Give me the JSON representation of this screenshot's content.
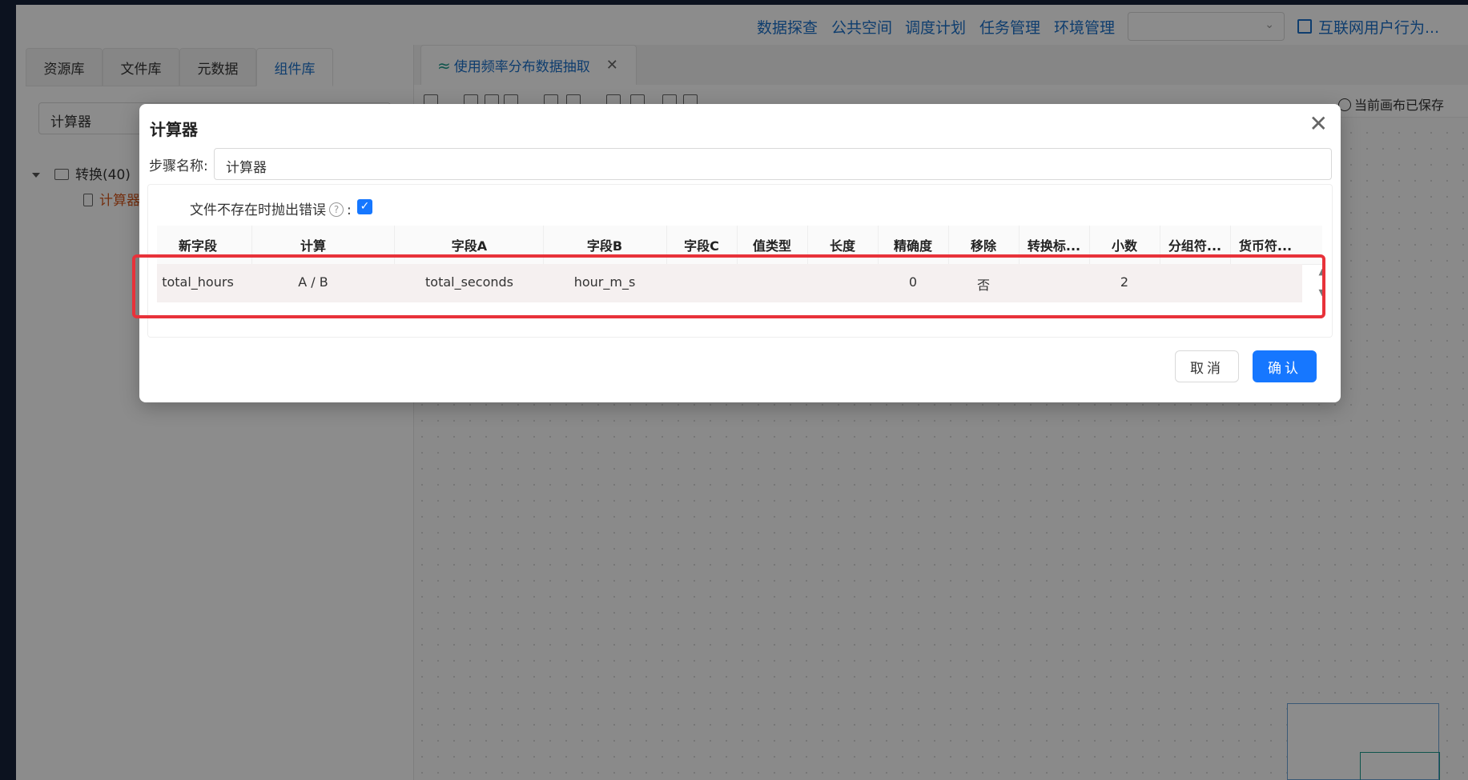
{
  "nav": {
    "items": [
      "数据探查",
      "公共空间",
      "调度计划",
      "任务管理",
      "环境管理"
    ],
    "project": "互联网用户行为..."
  },
  "left": {
    "tabs": [
      "资源库",
      "文件库",
      "元数据",
      "组件库"
    ],
    "active_tab": "组件库",
    "search_value": "计算器",
    "tree": {
      "folder": "转换(40)",
      "item": "计算器"
    }
  },
  "right": {
    "tab_title": "使用频率分布数据抽取",
    "save_status": "当前画布已保存"
  },
  "dialog": {
    "title": "计算器",
    "step_name_label": "步骤名称:",
    "step_name_value": "计算器",
    "option_label": "文件不存在时抛出错误",
    "option_colon": ":",
    "option_checked": true,
    "columns": [
      "新字段",
      "计算",
      "字段A",
      "字段B",
      "字段C",
      "值类型",
      "长度",
      "精确度",
      "移除",
      "转换标...",
      "小数",
      "分组符...",
      "货币符..."
    ],
    "rows": [
      {
        "new_field": "total_hours",
        "calc": "A / B",
        "field_a": "total_seconds",
        "field_b": "hour_m_s",
        "field_c": "",
        "value_type": "",
        "length": "",
        "precision": "0",
        "remove": "否",
        "conversion": "",
        "decimal": "2",
        "group": "",
        "currency": ""
      }
    ],
    "cancel_label": "取消",
    "ok_label": "确认"
  },
  "colors": {
    "accent": "#1677ff",
    "highlight": "#e8323a",
    "nav_link": "#1a6fc9"
  }
}
